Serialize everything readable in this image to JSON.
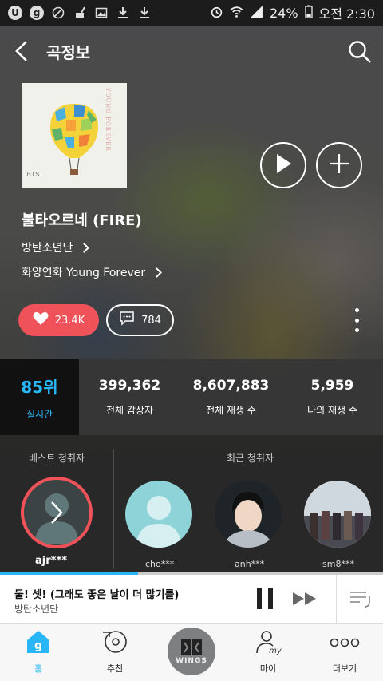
{
  "status_bar": {
    "battery": "24%",
    "time": "오전 2:30"
  },
  "header": {
    "title": "곡정보"
  },
  "album": {
    "cover_text_top": "YOUNG FOREVER",
    "cover_text_bottom": "BTS"
  },
  "song": {
    "title": "불타오르네 (FIRE)",
    "artist": "방탄소년단",
    "album": "화양연화 Young Forever"
  },
  "actions": {
    "likes": "23.4K",
    "comments": "784"
  },
  "stats": {
    "rank": "85위",
    "rank_label": "실시간",
    "items": [
      {
        "value": "399,362",
        "label": "전체 감상자"
      },
      {
        "value": "8,607,883",
        "label": "전체 재생 수"
      },
      {
        "value": "5,959",
        "label": "나의 재생 수"
      }
    ]
  },
  "listeners": {
    "best_label": "베스트 청취자",
    "recent_label": "최근 청취자",
    "best_name": "ajr***",
    "recent": [
      {
        "name": "cho***"
      },
      {
        "name": "anh***"
      },
      {
        "name": "sm8***"
      }
    ]
  },
  "player": {
    "title": "둘! 셋! (그래도 좋은 날이 더 많기를)",
    "artist": "방탄소년단",
    "progress": 0.36
  },
  "nav": {
    "items": [
      {
        "label": "홈",
        "active": true
      },
      {
        "label": "추천"
      },
      {
        "label": ""
      },
      {
        "label": "마이"
      },
      {
        "label": "더보기"
      }
    ],
    "wings_text": "WINGS"
  },
  "colors": {
    "accent": "#29b6f6",
    "like": "#f0525a"
  }
}
